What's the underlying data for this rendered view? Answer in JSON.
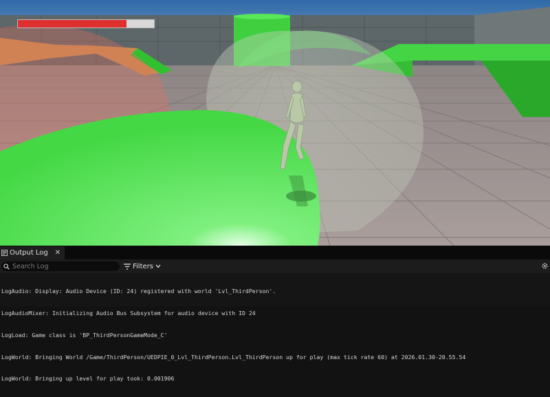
{
  "viewport": {
    "health": 0.8,
    "colors": {
      "sky": "#3a6fa8",
      "floor": "#a59a98",
      "ramp_green": "#4fdf4f",
      "sphere_green": "#5be85b",
      "health_red": "#df3030"
    }
  },
  "output_log": {
    "tab_label": "Output Log",
    "tab_close": "✕",
    "search_placeholder": "Search Log",
    "filters_label": "Filters",
    "lines": [
      "LogAudio: Display: Audio Device (ID: 24) registered with world 'Lvl_ThirdPerson'.",
      "LogAudioMixer: Initializing Audio Bus Subsystem for audio device with ID 24",
      "LogLoad: Game class is 'BP_ThirdPersonGameMode_C'",
      "LogWorld: Bringing World /Game/ThirdPerson/UEDPIE_0_Lvl_ThirdPerson.Lvl_ThirdPerson up for play (max tick rate 60) at 2026.01.30-20.55.54",
      "LogWorld: Bringing up level for play took: 0.001906"
    ]
  }
}
